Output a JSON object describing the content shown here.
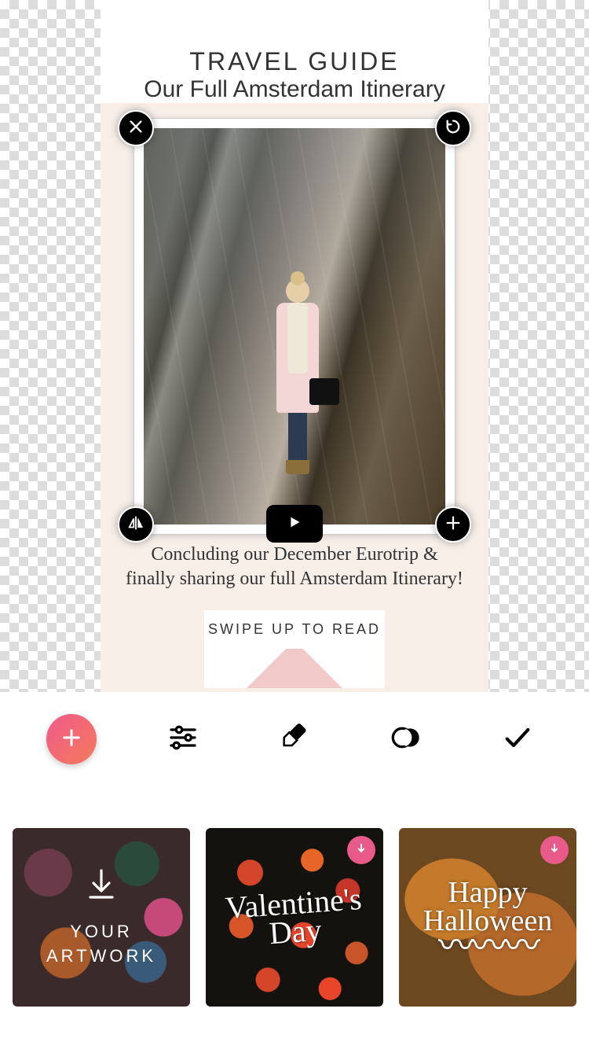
{
  "canvas": {
    "story": {
      "title": "TRAVEL GUIDE",
      "subtitle": "Our Full Amsterdam Itinerary",
      "caption_line1": "Concluding our December Eurotrip &",
      "caption_line2": "finally sharing our full Amsterdam Itinerary!",
      "swipe_label": "SWIPE UP TO READ"
    },
    "handles": {
      "close": "close-icon",
      "undo": "undo-icon",
      "flip": "flip-horizontal-icon",
      "add": "plus-icon",
      "play": "play-icon"
    }
  },
  "toolbar": {
    "add": "plus-icon",
    "settings": "sliders-icon",
    "erase": "eraser-icon",
    "mask": "mask-icon",
    "confirm": "check-icon"
  },
  "templates": [
    {
      "id": "your-artwork",
      "label_line1": "YOUR",
      "label_line2": "ARTWORK",
      "has_download_badge": false,
      "has_big_download_icon": true
    },
    {
      "id": "valentines-day",
      "label_line1": "Valentine's",
      "label_line2": "Day",
      "has_download_badge": true
    },
    {
      "id": "happy-halloween",
      "label_line1": "Happy",
      "label_line2": "Halloween",
      "has_download_badge": true
    }
  ],
  "colors": {
    "accent_pink": "#f05a8a",
    "accent_orange": "#f47a5c",
    "story_bg": "#f7eee8",
    "chevron_pink": "#f1c9c9"
  }
}
